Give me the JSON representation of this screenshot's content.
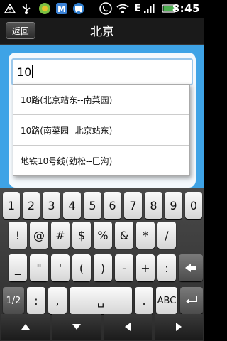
{
  "status_bar": {
    "time": "8:45",
    "battery_label": "",
    "icons": [
      "warning-icon",
      "usb-icon",
      "app-icon-green",
      "app-icon-blue",
      "app-icon-bus",
      "phone-wifi-icon",
      "wifi-icon",
      "e-network-icon",
      "signal-icon",
      "battery-icon"
    ],
    "network_letter": "E"
  },
  "header": {
    "back_label": "返回",
    "title": "北京"
  },
  "search": {
    "value": "10"
  },
  "suggestions": [
    {
      "label": "10路(北京站东--南菜园)"
    },
    {
      "label": "10路(南菜园--北京站东)"
    },
    {
      "label": "地铁10号线(劲松--巴沟)"
    }
  ],
  "keyboard": {
    "row1": [
      "1",
      "2",
      "3",
      "4",
      "5",
      "6",
      "7",
      "8",
      "9",
      "0"
    ],
    "row2": [
      "!",
      "@",
      "#",
      "$",
      "%",
      "&",
      "*",
      "/"
    ],
    "row3": [
      "_",
      "\"",
      "'",
      "(",
      ")",
      "-",
      "+",
      ":"
    ],
    "row4": {
      "mode_label": "1/2",
      "colon": ":",
      "comma": ",",
      "space": "␣",
      "period": ".",
      "abc_label": "ABC"
    }
  },
  "colors": {
    "accent": "#3ea3e6",
    "battery": "#4caf50"
  }
}
